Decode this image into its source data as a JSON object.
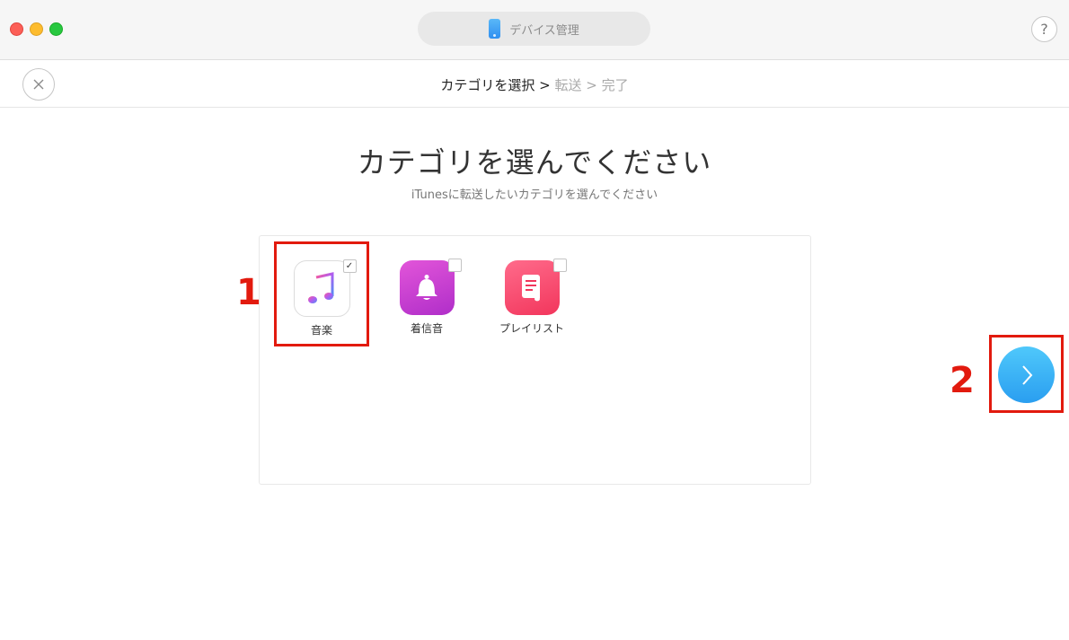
{
  "window": {
    "device_title": "デバイス管理",
    "help_label": "?"
  },
  "breadcrumb": {
    "step1": "カテゴリを選択 >",
    "step2": " 転送 > 完了"
  },
  "main": {
    "title": "カテゴリを選んでください",
    "subtitle": "iTunesに転送したいカテゴリを選んでください"
  },
  "categories": [
    {
      "label": "音楽",
      "icon": "music-note-icon",
      "checked": true,
      "check_mark": "✓"
    },
    {
      "label": "着信音",
      "icon": "bell-icon",
      "checked": false,
      "check_mark": ""
    },
    {
      "label": "プレイリスト",
      "icon": "playlist-icon",
      "checked": false,
      "check_mark": ""
    }
  ],
  "annotations": {
    "marker1": "1",
    "marker2": "2",
    "color": "#e21a0e"
  },
  "colors": {
    "accent": "#2a9ef0"
  }
}
